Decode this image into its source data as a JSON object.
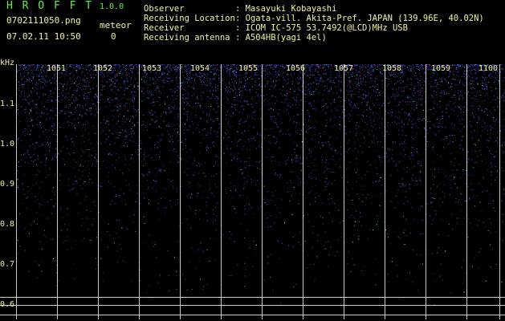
{
  "header": {
    "app_title": "H R O F F T",
    "version": "1.0.0",
    "filename": "0702111050.png",
    "datetime": "07.02.11 10:50",
    "meteor_label": "meteor",
    "meteor_count": "0",
    "info_labels": [
      "Observer",
      "Receiving Location",
      "Receiver",
      "Receiving antenna"
    ],
    "info_values": [
      ": Masayuki Kobayashi",
      ": Ogata-vill. Akita-Pref. JAPAN (139.96E, 40.02N)",
      ": ICOM IC-575 53.7492(@LCD)MHz USB",
      ": A504HB(yagi 4el)"
    ]
  },
  "plot": {
    "y_unit": "kHz",
    "y_ticks": [
      "1.1",
      "1.0",
      "0.9",
      "0.8",
      "0.7",
      "0.6"
    ],
    "x_ticks": [
      "1051",
      "1052",
      "1053",
      "1054",
      "1055",
      "1056",
      "1057",
      "1058",
      "1059",
      "1100"
    ]
  },
  "colors": {
    "text_yellow": "#f2f2a0",
    "title_green": "#66ee44",
    "noise_blue": "#2020d0"
  }
}
